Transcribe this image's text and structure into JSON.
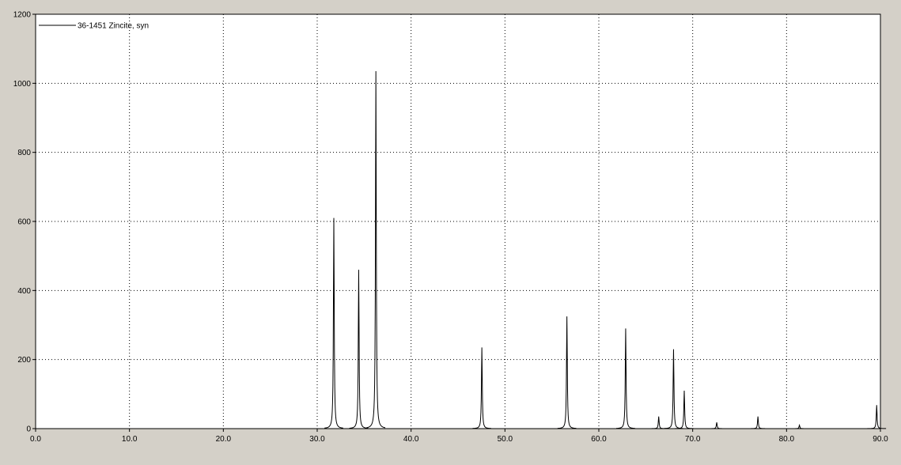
{
  "chart_data": {
    "type": "line",
    "title": "",
    "xlabel": "",
    "ylabel": "",
    "xlim": [
      0,
      90
    ],
    "ylim": [
      0,
      1200
    ],
    "x_ticks": [
      "0.0",
      "10.0",
      "20.0",
      "30.0",
      "40.0",
      "50.0",
      "60.0",
      "70.0",
      "80.0",
      "90.0"
    ],
    "y_ticks": [
      "0",
      "200",
      "400",
      "600",
      "800",
      "1000",
      "1200"
    ],
    "grid": true,
    "legend_position": "top-left",
    "colors": {
      "series": "#000000",
      "plot_bg": "#ffffff",
      "frame_bg": "#d4d0c8",
      "grid": "#000000"
    },
    "series": [
      {
        "name": "36-1451 Zincite, syn",
        "peak_width": 0.05,
        "peaks": [
          {
            "x": 31.77,
            "y": 610
          },
          {
            "x": 34.42,
            "y": 460
          },
          {
            "x": 36.25,
            "y": 1035
          },
          {
            "x": 47.54,
            "y": 235
          },
          {
            "x": 56.6,
            "y": 325
          },
          {
            "x": 62.86,
            "y": 290
          },
          {
            "x": 66.38,
            "y": 35
          },
          {
            "x": 67.96,
            "y": 230
          },
          {
            "x": 69.1,
            "y": 110
          },
          {
            "x": 72.56,
            "y": 18
          },
          {
            "x": 76.95,
            "y": 35
          },
          {
            "x": 81.37,
            "y": 10
          },
          {
            "x": 89.6,
            "y": 68
          }
        ]
      }
    ]
  }
}
